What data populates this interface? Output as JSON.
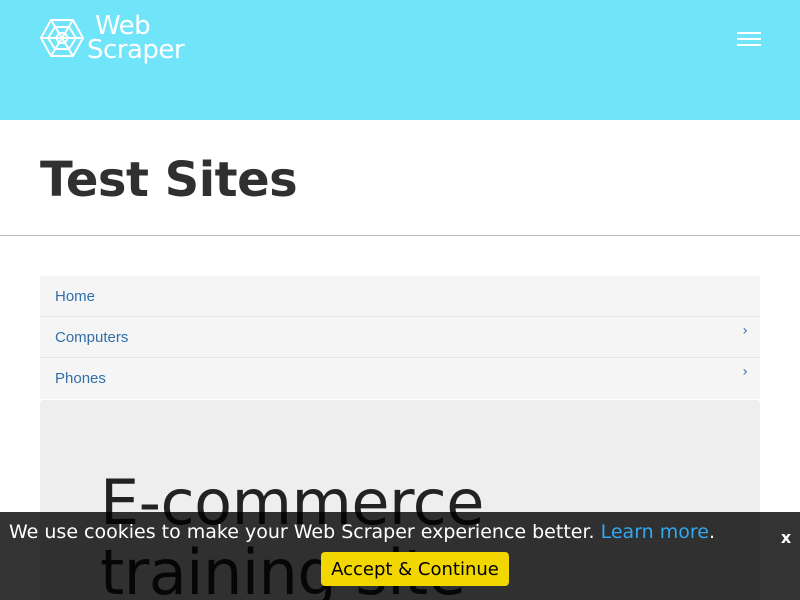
{
  "brand": {
    "name_line1": "Web",
    "name_line2": "Scraper"
  },
  "header": {
    "menu_icon": "hamburger-menu-icon"
  },
  "page": {
    "title": "Test Sites"
  },
  "sidebar": {
    "items": [
      {
        "label": "Home",
        "has_submenu": false
      },
      {
        "label": "Computers",
        "has_submenu": true,
        "icon": "chevron-right-icon",
        "icon_glyph": "›"
      },
      {
        "label": "Phones",
        "has_submenu": true,
        "icon": "chevron-right-icon",
        "icon_glyph": "›"
      }
    ]
  },
  "jumbotron": {
    "title": "E-commerce training site"
  },
  "cookie_banner": {
    "message": "We use cookies to make your Web Scraper experience better.",
    "learn_more": "Learn more",
    "period": ".",
    "accept_label": "Accept & Continue",
    "close_label": "x"
  },
  "colors": {
    "header_bg": "#70e4f9",
    "link": "#2f6fa8",
    "accept_bg": "#f1d600",
    "banner_link": "#31a8f0"
  }
}
